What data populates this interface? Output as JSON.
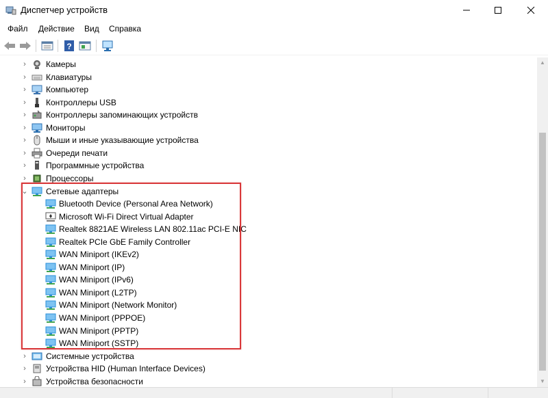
{
  "window": {
    "title": "Диспетчер устройств",
    "minimize_glyph": "—",
    "maximize_glyph": "☐",
    "close_glyph": "✕"
  },
  "menu": {
    "items": [
      "Файл",
      "Действие",
      "Вид",
      "Справка"
    ]
  },
  "toolbar": {
    "buttons": [
      "back-arrow-icon",
      "forward-arrow-icon",
      "properties-icon",
      "help-icon",
      "update-driver-icon",
      "scan-hardware-icon"
    ]
  },
  "tree": {
    "categories_before": [
      {
        "label": "Камеры",
        "icon": "camera-icon",
        "expanded": false
      },
      {
        "label": "Клавиатуры",
        "icon": "keyboard-icon",
        "expanded": false
      },
      {
        "label": "Компьютер",
        "icon": "computer-icon",
        "expanded": false
      },
      {
        "label": "Контроллеры USB",
        "icon": "usb-icon",
        "expanded": false
      },
      {
        "label": "Контроллеры запоминающих устройств",
        "icon": "storage-controller-icon",
        "expanded": false
      },
      {
        "label": "Мониторы",
        "icon": "monitor-icon",
        "expanded": false
      },
      {
        "label": "Мыши и иные указывающие устройства",
        "icon": "mouse-icon",
        "expanded": false
      },
      {
        "label": "Очереди печати",
        "icon": "printer-icon",
        "expanded": false
      },
      {
        "label": "Программные устройства",
        "icon": "software-device-icon",
        "expanded": false
      },
      {
        "label": "Процессоры",
        "icon": "processor-icon",
        "expanded": false
      }
    ],
    "network_category": {
      "label": "Сетевые адаптеры",
      "icon": "network-adapter-icon",
      "expanded": true
    },
    "network_adapters": [
      "Bluetooth Device (Personal Area Network)",
      "Microsoft Wi-Fi Direct Virtual Adapter",
      "Realtek 8821AE Wireless LAN 802.11ac PCI-E NIC",
      "Realtek PCIe GbE Family Controller",
      "WAN Miniport (IKEv2)",
      "WAN Miniport (IP)",
      "WAN Miniport (IPv6)",
      "WAN Miniport (L2TP)",
      "WAN Miniport (Network Monitor)",
      "WAN Miniport (PPPOE)",
      "WAN Miniport (PPTP)",
      "WAN Miniport (SSTP)"
    ],
    "categories_after": [
      {
        "label": "Системные устройства",
        "icon": "system-device-icon",
        "expanded": false
      },
      {
        "label": "Устройства HID (Human Interface Devices)",
        "icon": "hid-icon",
        "expanded": false
      },
      {
        "label": "Устройства безопасности",
        "icon": "security-device-icon",
        "expanded": false
      }
    ]
  },
  "colors": {
    "highlight_border": "#d9383a",
    "network_icon_blue": "#2a8fd8",
    "network_icon_green": "#3fa34d"
  }
}
